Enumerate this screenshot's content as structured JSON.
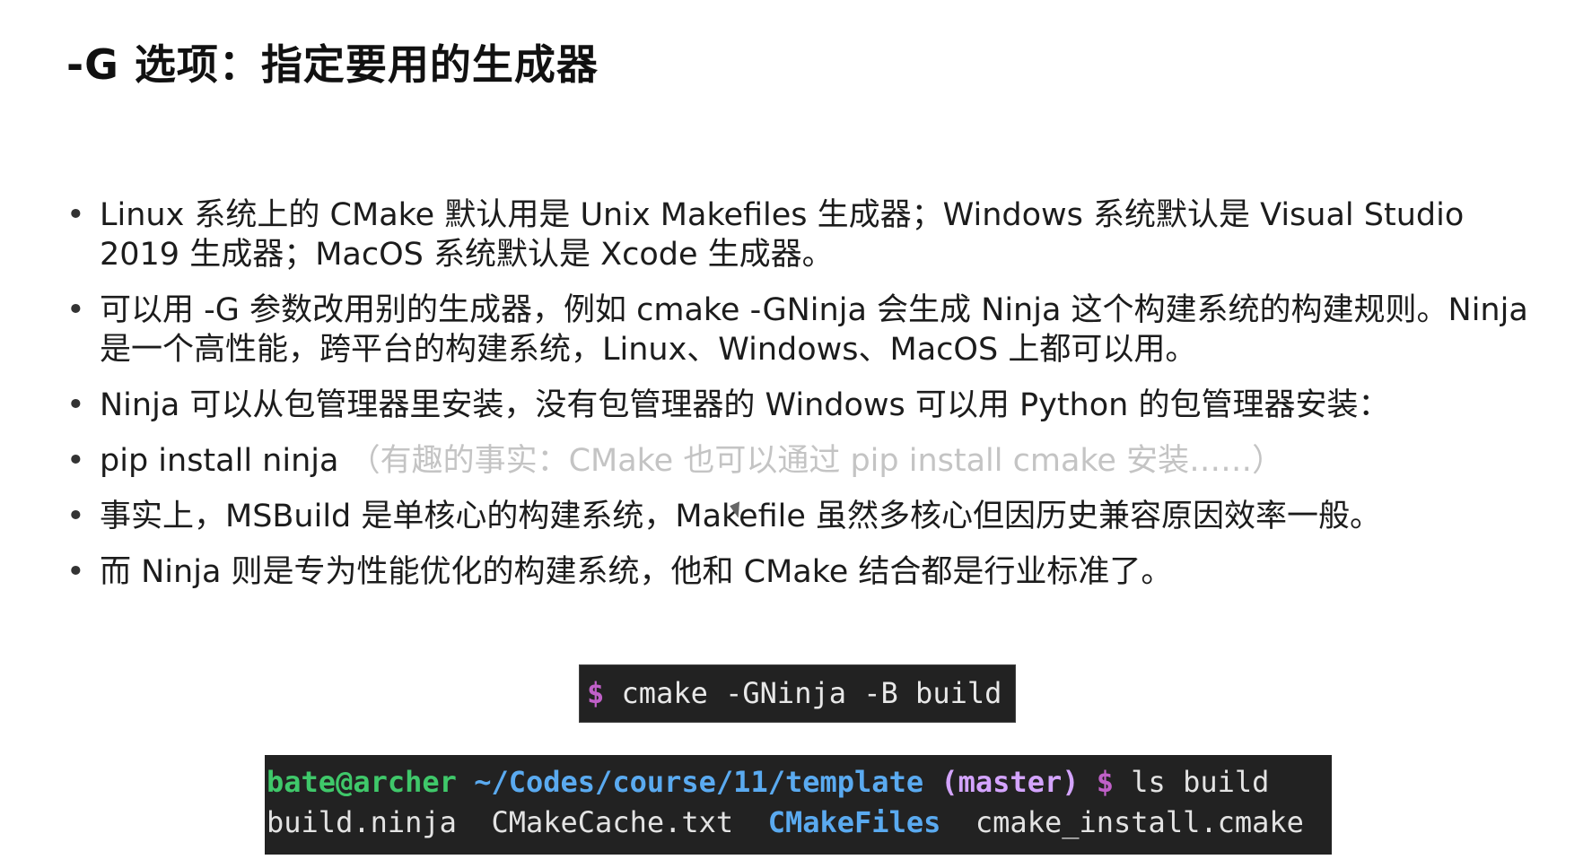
{
  "slide": {
    "title": "-G 选项：指定要用的生成器",
    "bullets": [
      {
        "text": "Linux 系统上的 CMake 默认用是 Unix Makefiles 生成器；Windows 系统默认是 Visual Studio 2019 生成器；MacOS 系统默认是 Xcode 生成器。"
      },
      {
        "text": "可以用 -G 参数改用别的生成器，例如 cmake -GNinja 会生成 Ninja 这个构建系统的构建规则。Ninja 是一个高性能，跨平台的构建系统，Linux、Windows、MacOS 上都可以用。"
      },
      {
        "text": "Ninja 可以从包管理器里安装，没有包管理器的 Windows 可以用 Python 的包管理器安装："
      },
      {
        "text": "pip install ninja ",
        "aside": "（有趣的事实：CMake 也可以通过 pip install cmake 安装……）"
      },
      {
        "text": "事实上，MSBuild 是单核心的构建系统，Makefile 虽然多核心但因历史兼容原因效率一般。"
      },
      {
        "text": "而 Ninja 则是专为性能优化的构建系统，他和 CMake 结合都是行业标准了。"
      }
    ]
  },
  "command": {
    "prompt": "$",
    "text": " cmake -GNinja -B build"
  },
  "terminal": {
    "user_host": "bate@archer",
    "path": "~/Codes/course/11/template",
    "branch": "(master)",
    "prompt": "$",
    "command": "ls build",
    "files": [
      {
        "name": "build.ninja",
        "is_dir": false
      },
      {
        "name": "CMakeCache.txt",
        "is_dir": false
      },
      {
        "name": "CMakeFiles",
        "is_dir": true
      },
      {
        "name": "cmake_install.cmake",
        "is_dir": false
      }
    ]
  },
  "colors": {
    "terminal_bg": "#222222",
    "user_green": "#3fc86a",
    "path_blue": "#5aaaf0",
    "branch_purple": "#d4a4ff",
    "prompt_magenta": "#c060c8",
    "aside_gray": "#c4c4c4"
  }
}
